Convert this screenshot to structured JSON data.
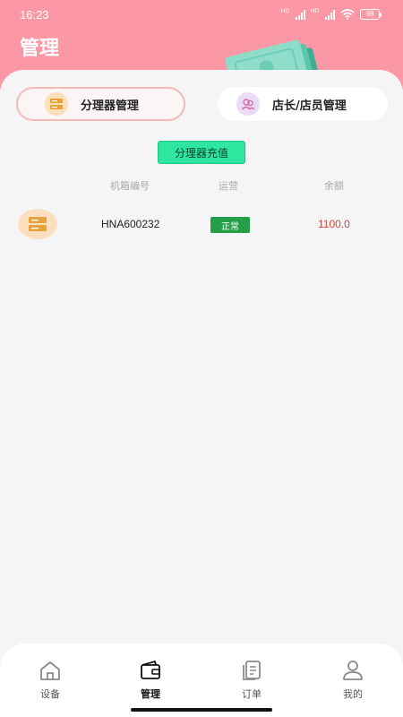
{
  "status_bar": {
    "time": "16:23",
    "network_1": "HD",
    "network_2": "HD",
    "battery": "98"
  },
  "header": {
    "title": "管理"
  },
  "tabs": [
    {
      "label": "分理器管理",
      "icon": "server-icon",
      "active": true
    },
    {
      "label": "店长/店员管理",
      "icon": "users-icon",
      "active": false
    }
  ],
  "recharge_button": {
    "label": "分理器充值"
  },
  "table": {
    "columns": [
      "机箱编号",
      "运营",
      "余额"
    ],
    "rows": [
      {
        "icon": "server-icon",
        "id": "HNA600232",
        "status": "正常",
        "balance": "1100.0"
      }
    ]
  },
  "bottom_nav": {
    "items": [
      {
        "label": "设备",
        "icon": "home-icon",
        "active": false
      },
      {
        "label": "管理",
        "icon": "wallet-icon",
        "active": true
      },
      {
        "label": "订单",
        "icon": "order-icon",
        "active": false
      },
      {
        "label": "我的",
        "icon": "user-icon",
        "active": false
      }
    ]
  },
  "colors": {
    "header": "#fc97a6",
    "accent_green": "#2ee6a0",
    "status_green": "#23a047",
    "balance_red": "#d2463a"
  }
}
